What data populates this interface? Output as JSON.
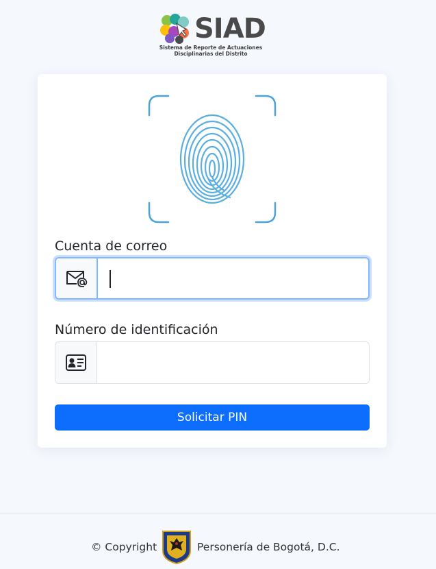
{
  "header": {
    "logo_title": "SIAD",
    "logo_subtitle_line1": "Sistema de Reporte de Actuaciones",
    "logo_subtitle_line2": "Disciplinarias del Distrito"
  },
  "form": {
    "email_label": "Cuenta de correo",
    "email_value": "",
    "email_icon": "envelope-at-icon",
    "id_label": "Número de identificación",
    "id_value": "",
    "id_icon": "id-card-icon",
    "submit_label": "Solicitar PIN"
  },
  "footer": {
    "copyright": "© Copyright",
    "organization": "Personería de Bogotá, D.C."
  },
  "colors": {
    "primary": "#0d6efd",
    "fingerprint": "#4aa3dc",
    "background": "#f5f8fd"
  }
}
